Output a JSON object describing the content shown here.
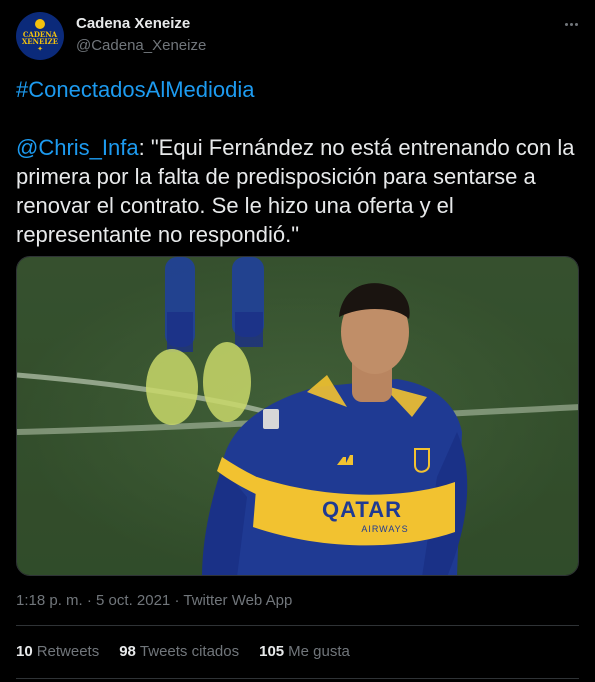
{
  "author": {
    "display_name": "Cadena Xeneize",
    "handle": "@Cadena_Xeneize",
    "avatar_text": "CADENA\nXENEIZE"
  },
  "tweet": {
    "hashtag": "#ConectadosAlMediodia",
    "mention": "@Chris_Infa",
    "quote": ": \"Equi Fernández no está entrenando con la primera por la falta de predisposición para sentarse a renovar el contrato. Se le hizo una oferta y el representante no respondió.\"",
    "image_sponsor_text": "QATAR",
    "image_sponsor_sub": "AIRWAYS"
  },
  "meta": {
    "time": "1:18 p. m.",
    "separator": "·",
    "date": "5 oct. 2021",
    "source": "Twitter Web App"
  },
  "stats": [
    {
      "count": "10",
      "label": "Retweets"
    },
    {
      "count": "98",
      "label": "Tweets citados"
    },
    {
      "count": "105",
      "label": "Me gusta"
    }
  ],
  "colors": {
    "background": "#000000",
    "text": "#e7e9ea",
    "secondary": "#71767b",
    "link": "#1d9bf0",
    "boca_blue": "#1f3a93",
    "boca_gold": "#f2c230"
  },
  "icons": {
    "more": "more-horizontal-icon",
    "bird": "bird-icon"
  }
}
